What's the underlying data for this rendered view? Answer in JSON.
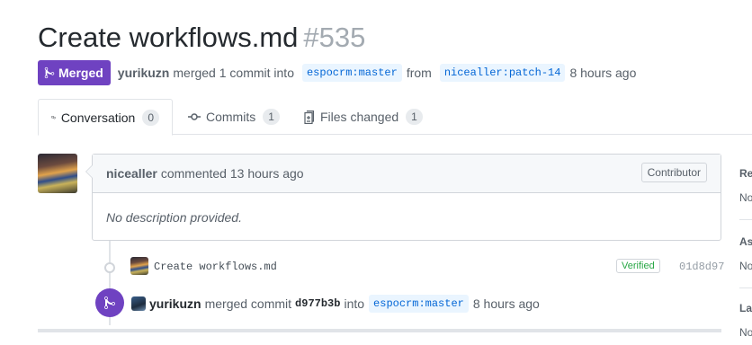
{
  "pr": {
    "title": "Create workflows.md",
    "number": "#535",
    "state": "Merged",
    "merged_by": "yurikuzn",
    "merged_text": "merged 1 commit into",
    "base_branch": "espocrm:master",
    "from_text": "from",
    "head_branch": "nicealler:patch-14",
    "time": "8 hours ago"
  },
  "tabs": [
    {
      "label": "Conversation",
      "count": "0"
    },
    {
      "label": "Commits",
      "count": "1"
    },
    {
      "label": "Files changed",
      "count": "1"
    }
  ],
  "comment": {
    "author": "nicealler",
    "action": "commented 13 hours ago",
    "role": "Contributor",
    "body": "No description provided."
  },
  "commit": {
    "message": "Create workflows.md",
    "verified": "Verified",
    "sha": "01d8d97"
  },
  "merge_event": {
    "author": "yurikuzn",
    "text": "merged commit",
    "sha": "d977b3b",
    "into": "into",
    "branch": "espocrm:master",
    "time": "8 hours ago"
  },
  "sidebar": {
    "items": [
      {
        "head": "Re",
        "value": "No"
      },
      {
        "head": "As",
        "value": "No"
      },
      {
        "head": "La",
        "value": "No"
      }
    ]
  },
  "colors": {
    "merged": "#6f42c1",
    "branch_bg": "#eaf5ff",
    "branch_fg": "#0366d6",
    "verified": "#28a745"
  }
}
